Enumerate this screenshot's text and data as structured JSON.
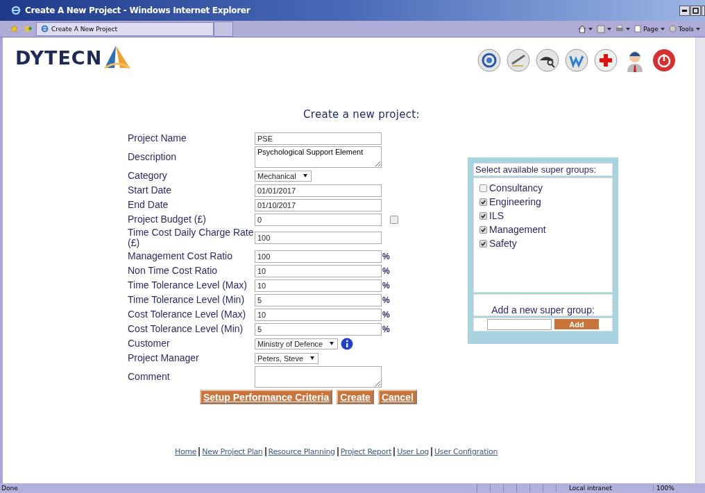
{
  "window": {
    "title": "Create A New Project - Windows Internet Explorer"
  },
  "tabs": [
    {
      "label": "Create A New Project",
      "selected": true
    }
  ],
  "command_bar": [
    {
      "label": "Page",
      "kind": "page"
    },
    {
      "label": "Tools",
      "kind": "tools"
    }
  ],
  "logo": "DYTECN",
  "page_title": "Create a new project:",
  "fields": [
    {
      "label": "Project Name",
      "kind": "text",
      "value": "PSE"
    },
    {
      "label": "Description",
      "kind": "textarea",
      "value": "Psychological Support Element"
    },
    {
      "label": "Category",
      "kind": "select",
      "value": "Mechanical"
    },
    {
      "label": "Start Date",
      "kind": "text",
      "value": "01/01/2017"
    },
    {
      "label": "End Date",
      "kind": "text",
      "value": "01/10/2017"
    },
    {
      "label": "Project Budget (£)",
      "kind": "text",
      "value": "0",
      "checkbox": {
        "checked": false
      }
    },
    {
      "label": "Time Cost Daily Charge Rate (£)",
      "kind": "text",
      "value": "100"
    },
    {
      "label": "Management Cost Ratio",
      "kind": "text",
      "value": "100",
      "suffix": "%"
    },
    {
      "label": "Non Time Cost Ratio",
      "kind": "text",
      "value": "10",
      "suffix": "%"
    },
    {
      "label": "Time Tolerance Level (Max)",
      "kind": "text",
      "value": "10",
      "suffix": "%"
    },
    {
      "label": "Time Tolerance Level (Min)",
      "kind": "text",
      "value": "5",
      "suffix": "%"
    },
    {
      "label": "Cost Tolerance Level (Max)",
      "kind": "text",
      "value": "10",
      "suffix": "%"
    },
    {
      "label": "Cost Tolerance Level (Min)",
      "kind": "text",
      "value": "5",
      "suffix": "%"
    },
    {
      "label": "Customer",
      "kind": "select",
      "value": "Ministry of Defence",
      "info": true
    },
    {
      "label": "Project Manager",
      "kind": "select",
      "value": "Peters, Steve"
    },
    {
      "label": "Comment",
      "kind": "textarea"
    }
  ],
  "buttons": [
    "Setup Performance Criteria",
    "Create",
    "Cancel"
  ],
  "super_groups": {
    "heading": "Select available super groups:",
    "items": [
      {
        "label": "Consultancy",
        "checked": false
      },
      {
        "label": "Engineering",
        "checked": true
      },
      {
        "label": "ILS",
        "checked": true
      },
      {
        "label": "Management",
        "checked": true
      },
      {
        "label": "Safety",
        "checked": true
      }
    ],
    "add_label": "Add a new super group:",
    "add_button": "Add"
  },
  "footer_links": [
    "Home",
    "New Project Plan",
    "Resource Planning",
    "Project Report",
    "User Log",
    "User Configration"
  ],
  "status_bar": {
    "status": "Done",
    "zone": "Local intranet",
    "zoom": "100%"
  }
}
